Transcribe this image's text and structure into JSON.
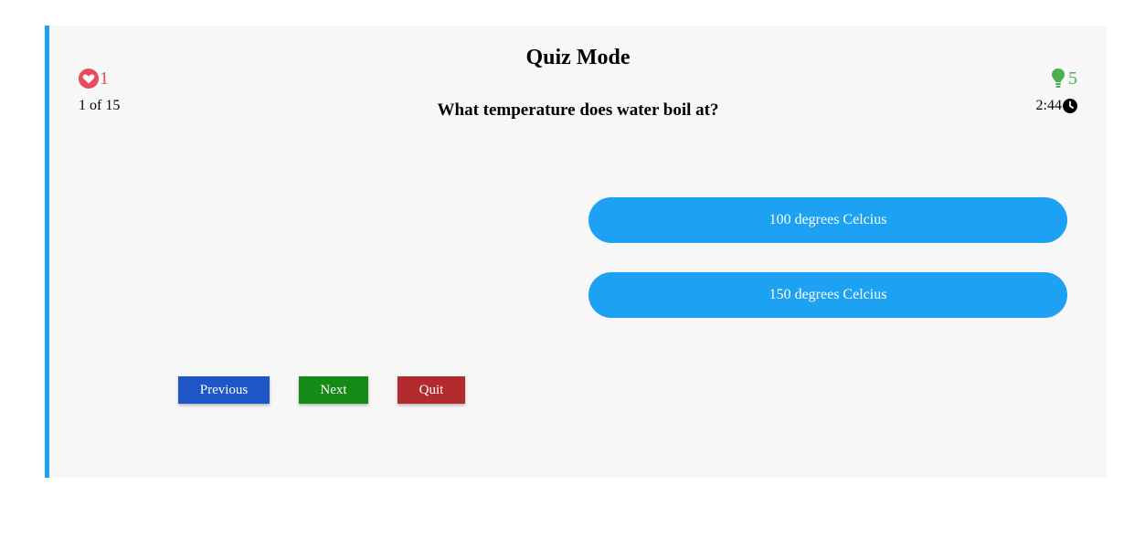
{
  "quiz": {
    "title": "Quiz Mode",
    "lives": "1",
    "counter": "1 of 15",
    "question": "What temperature does water boil at?",
    "hints": "5",
    "timer": "2:44"
  },
  "options": [
    "100 degrees Celcius",
    "150 degrees Celcius"
  ],
  "buttons": {
    "previous": "Previous",
    "next": "Next",
    "quit": "Quit"
  },
  "icons": {
    "lives": "heart-icon",
    "hints": "lightbulb-icon",
    "timer": "clock-icon"
  },
  "colors": {
    "accent": "#1da1f2",
    "lives": "#e84a5f",
    "hints": "#4caf50",
    "previous": "#1e56c7",
    "next": "#158a17",
    "quit": "#b22a2e"
  }
}
